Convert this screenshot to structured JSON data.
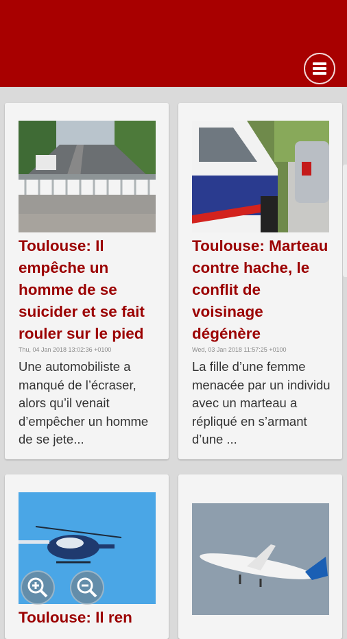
{
  "header": {
    "menu_icon": "hamburger-menu-icon",
    "brand_color": "#a80000"
  },
  "articles": [
    {
      "title": "Toulouse: Il empêche un homme de se suicider et se fait rouler sur le pied",
      "date": "Thu, 04 Jan 2018 13:02:36 +0100",
      "excerpt": "Une automobiliste a manqué de l’écraser, alors qu’il venait d’empêcher un homme de se jete..."
    },
    {
      "title": "Toulouse: Marteau contre hache, le conflit de voisinage dégénère",
      "date": "Wed, 03 Jan 2018 11:57:25 +0100",
      "excerpt": "La fille d’une femme menacée par un individu avec un marteau a répliqué en s’armant d’une ..."
    },
    {
      "title": "Toulouse: Il ren"
    },
    {
      "title": ""
    }
  ],
  "zoom": {
    "in_icon": "zoom-in-icon",
    "out_icon": "zoom-out-icon"
  },
  "colors": {
    "title": "#9b0000",
    "page_background": "#dadada",
    "card": "#f4f4f4"
  }
}
